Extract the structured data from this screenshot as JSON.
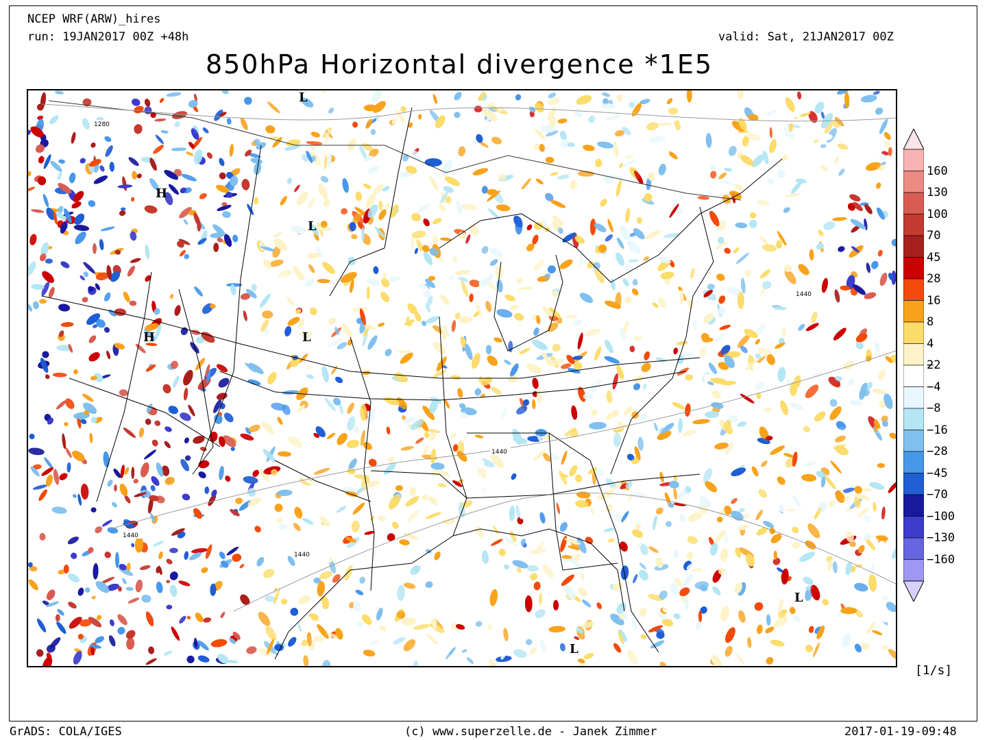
{
  "header": {
    "model": "NCEP WRF(ARW)_hires",
    "run": "run: 19JAN2017 00Z +48h",
    "valid": "valid: Sat, 21JAN2017 00Z",
    "title": "850hPa Horizontal divergence *1E5"
  },
  "map": {
    "pressure_systems": [
      {
        "type": "H"
      },
      {
        "type": "H"
      },
      {
        "type": "L"
      },
      {
        "type": "L"
      },
      {
        "type": "L"
      },
      {
        "type": "L"
      },
      {
        "type": "L"
      }
    ],
    "contour_labels": [
      "1280",
      "1440",
      "1440",
      "1440",
      "1440"
    ]
  },
  "colorbar": {
    "levels": [
      "160",
      "130",
      "100",
      "70",
      "45",
      "28",
      "16",
      "8",
      "4",
      "2",
      "−2",
      "−4",
      "−8",
      "−16",
      "−28",
      "−45",
      "−70",
      "−100",
      "−130",
      "−160"
    ],
    "colors": [
      "#f7b2b2",
      "#ec8a84",
      "#d95c52",
      "#c43a30",
      "#a8201c",
      "#cc0000",
      "#f24a0a",
      "#f8a21c",
      "#fbdc6a",
      "#fdf2c8",
      "#ffffff",
      "#e8f7fc",
      "#b4e6f4",
      "#80bfee",
      "#4897ea",
      "#1f5ed4",
      "#19199e",
      "#3c3ccd",
      "#6666e0",
      "#9e98f4"
    ],
    "top_cap_color": "#fbe4e6",
    "bottom_cap_color": "#d8d0fc",
    "units": "[1/s]"
  },
  "footer": {
    "left": "GrADS: COLA/IGES",
    "center": "(c) www.superzelle.de - Janek Zimmer",
    "right": "2017-01-19-09:48"
  }
}
